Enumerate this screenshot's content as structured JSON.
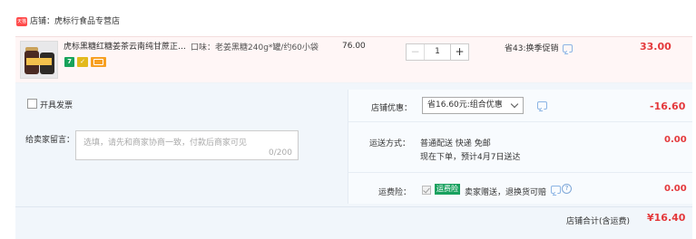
{
  "shop": {
    "logo_text": "天猫",
    "label": "店铺：",
    "name": "虎标行食品专营店"
  },
  "item": {
    "title": "虎标黑糖红糖姜茶云南纯甘蔗正宗古法黑糖块",
    "badges": [
      "7",
      "S",
      "card"
    ],
    "sku_label": "口味：",
    "sku_value": "老姜黑糖240g*罐/约60小袋",
    "price": "76.00",
    "quantity": "1",
    "minus": "−",
    "plus": "+",
    "promo": "省43:换季促销",
    "subtotal": "33.00"
  },
  "invoice": {
    "label": "开具发票",
    "checked": false
  },
  "message": {
    "label": "给卖家留言：",
    "placeholder": "选填，请先和商家协商一致，付款后商家可见",
    "counter": "0/200"
  },
  "coupon": {
    "label": "店铺优惠：",
    "selected": "省16.60元:组合优惠",
    "amount": "-16.60"
  },
  "shipping": {
    "label": "运送方式：",
    "line1": "普通配送 快递 免邮",
    "line2": "现在下单，预计4月7日送达",
    "amount": "0.00"
  },
  "insurance": {
    "label": "运费险：",
    "badge": "运费险",
    "text": "卖家赠送，退换货可赔",
    "help": "?",
    "amount": "0.00"
  },
  "total": {
    "label": "店铺合计(含运费)",
    "amount": "¥16.40"
  },
  "colors": {
    "accent_red": "#e4393c",
    "tmall_red": "#ff4a4a",
    "insurance_green": "#19a15f",
    "panel_bg": "#f1f6fb",
    "item_bg": "#fff6f6"
  }
}
